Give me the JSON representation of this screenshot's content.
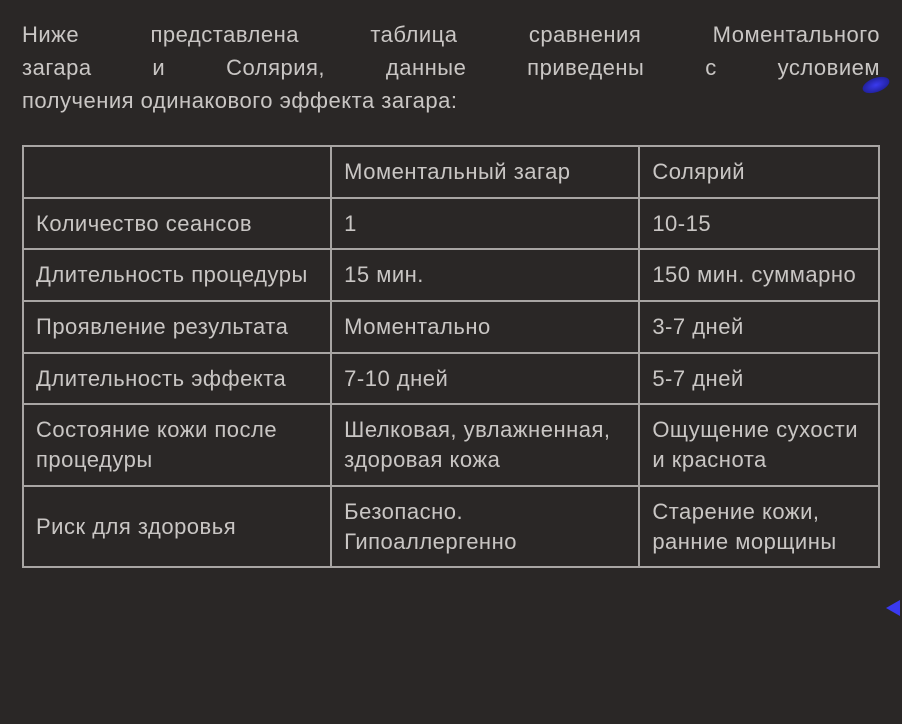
{
  "intro": {
    "line1": "Ниже представлена таблица сравнения Моментального",
    "line2": "загара и Солярия, данные приведены с условием",
    "line3": "получения одинакового эффекта загара:"
  },
  "table": {
    "header": {
      "col0": "",
      "col1": "Моментальный загар",
      "col2": "Солярий"
    },
    "rows": [
      {
        "label": "Количество сеансов",
        "c1": "1",
        "c2": "10-15"
      },
      {
        "label": "Длительность процедуры",
        "c1": "15 мин.",
        "c2": "150 мин. суммарно"
      },
      {
        "label": "Проявление результата",
        "c1": "Моментально",
        "c2": "3-7 дней"
      },
      {
        "label": "Длительность эффекта",
        "c1": "7-10 дней",
        "c2": "5-7 дней"
      },
      {
        "label": "Состояние кожи после процедуры",
        "c1": "Шелковая, увлажненная, здоровая кожа",
        "c2": "Ощущение сухости и краснота"
      },
      {
        "label": "Риск для здоровья",
        "c1": "Безопасно. Гипоаллергенно",
        "c2": "Старение кожи, ранние морщины"
      }
    ]
  }
}
